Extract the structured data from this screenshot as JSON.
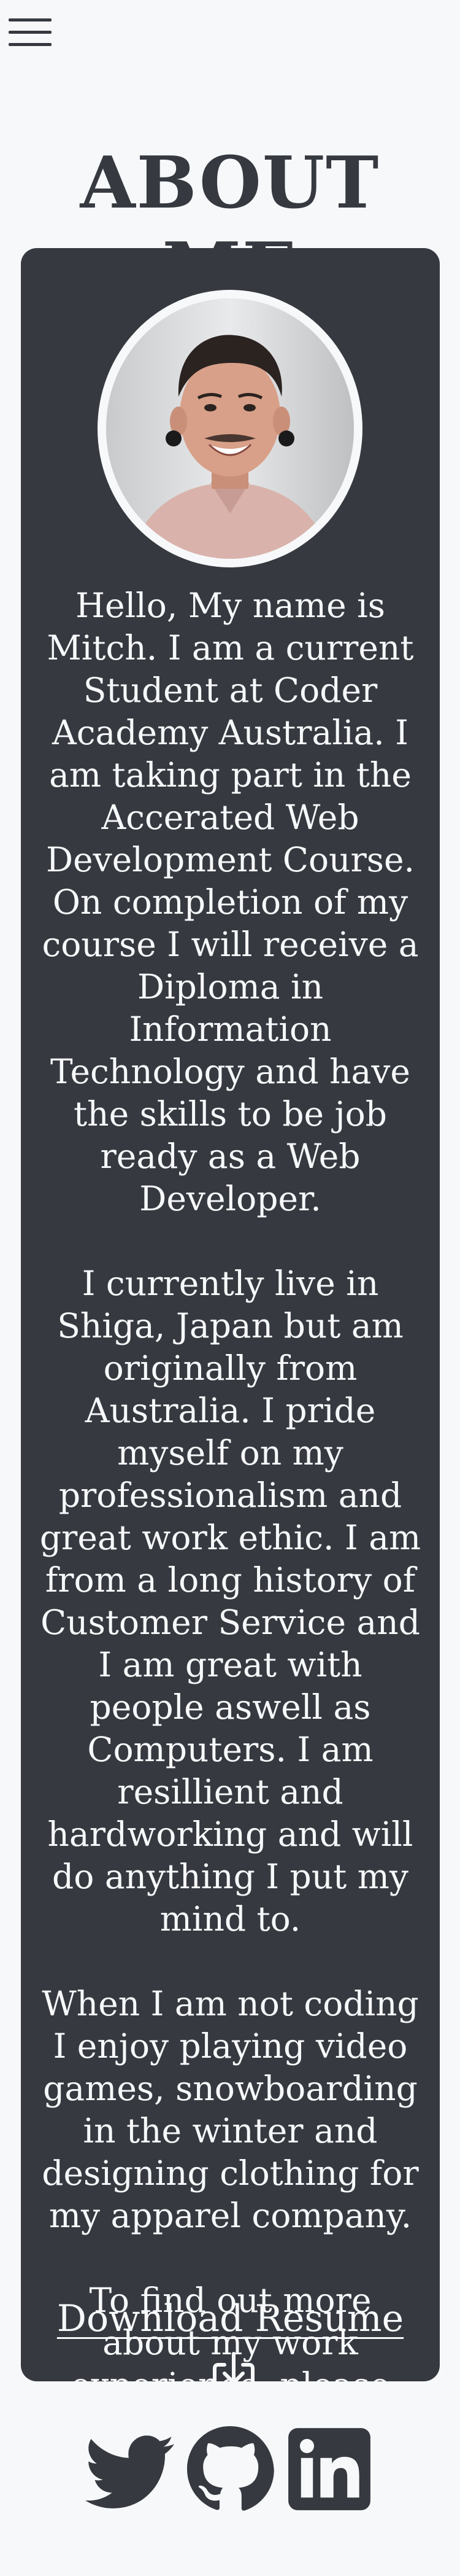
{
  "nav": {
    "menu_icon": "hamburger-menu-icon"
  },
  "header": {
    "title": "ABOUT ME"
  },
  "profile": {
    "photo": "profile-photo"
  },
  "bio": {
    "paragraphs": [
      "Hello, My name is Mitch. I am a current Student at Coder Academy Australia. I am taking part in the Accerated Web Development Course. On completion of my course I will receive a Diploma in Information Technology and have the skills to be job ready as a Web Developer.",
      "I currently live in Shiga, Japan but am originally from Australia. I pride myself on my professionalism and great work ethic. I am from a long history of Customer Service and I am great with people aswell as Computers. I am resillient and hardworking and will do anything I put my mind to.",
      "When I am not coding I enjoy playing video games, snowboarding in the winter and designing clothing for my apparel company.",
      "To find out more about my work experience, please take a look at my resume at the link below."
    ]
  },
  "download": {
    "label": "Download Resume",
    "icon": "download-icon"
  },
  "socials": [
    {
      "icon": "twitter-icon"
    },
    {
      "icon": "github-icon"
    },
    {
      "icon": "linkedin-icon"
    }
  ],
  "colors": {
    "background": "#f7f8fa",
    "card": "#363a40",
    "text_light": "#f7f8fa",
    "text_dark": "#363a40"
  }
}
